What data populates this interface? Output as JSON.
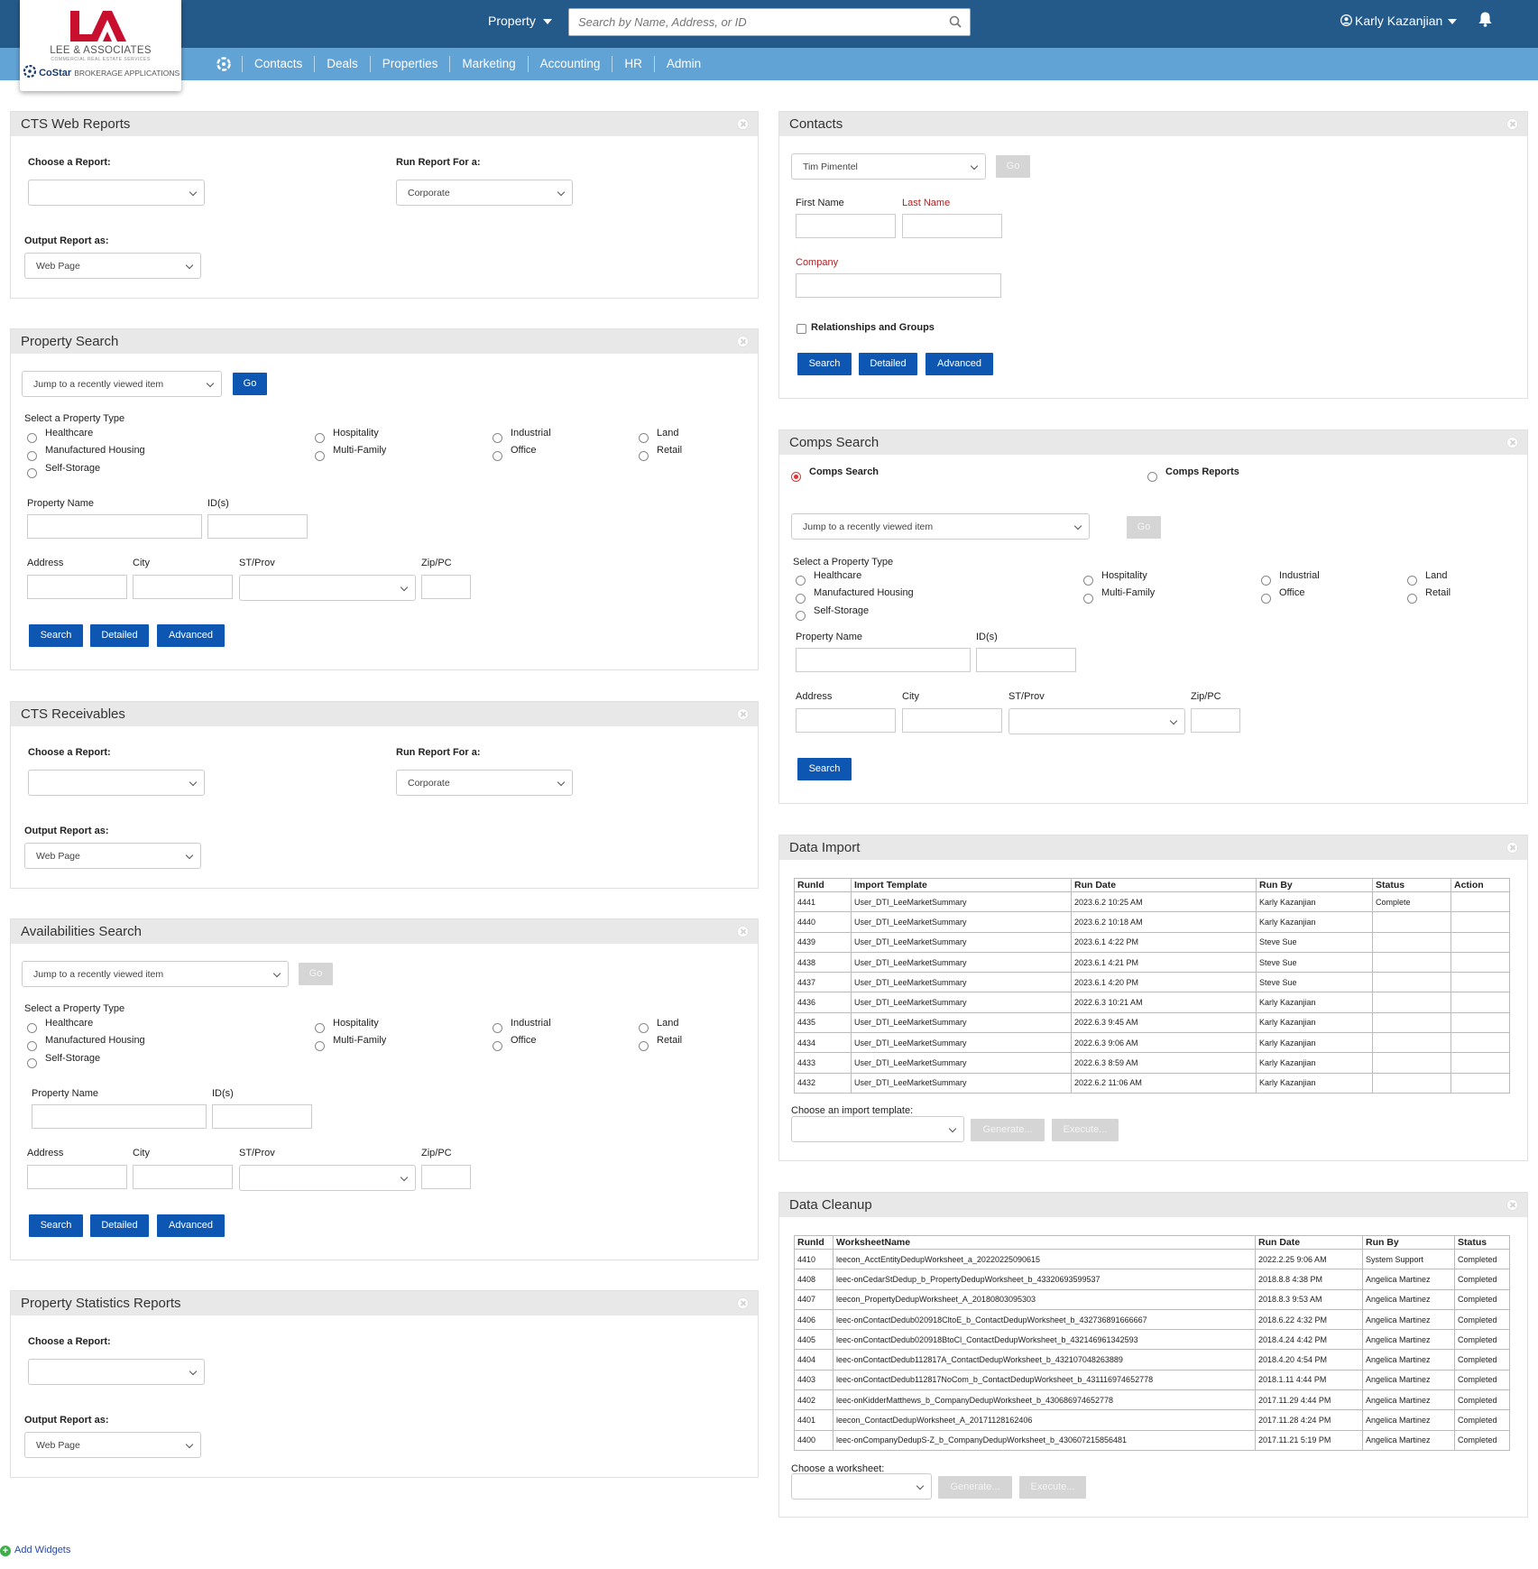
{
  "header": {
    "logo": {
      "name": "LEE & ASSOCIATES",
      "sub": "COMMERCIAL REAL ESTATE SERVICES",
      "costar_brand": "CoStar",
      "costar_sub": "BROKERAGE APPLICATIONS"
    },
    "property_dropdown": "Property",
    "search_placeholder": "Search by Name, Address, or ID",
    "user": "Karly Kazanjian"
  },
  "nav": [
    "Contacts",
    "Deals",
    "Properties",
    "Marketing",
    "Accounting",
    "HR",
    "Admin"
  ],
  "cts_web_reports": {
    "title": "CTS Web Reports",
    "choose_label": "Choose a Report:",
    "choose_value": "",
    "run_for_label": "Run Report For a:",
    "run_for_value": "Corporate",
    "output_label": "Output Report as:",
    "output_value": "Web Page"
  },
  "property_search": {
    "title": "Property Search",
    "jump_value": "Jump to a recently viewed item",
    "go": "Go",
    "type_label": "Select a Property Type",
    "types": [
      "Healthcare",
      "Manufactured Housing",
      "Self-Storage",
      "Hospitality",
      "Multi-Family",
      "Industrial",
      "Office",
      "Land",
      "Retail"
    ],
    "property_name_label": "Property Name",
    "ids_label": "ID(s)",
    "address_label": "Address",
    "city_label": "City",
    "st_label": "ST/Prov",
    "zip_label": "Zip/PC",
    "search": "Search",
    "detailed": "Detailed",
    "advanced": "Advanced"
  },
  "cts_receivables": {
    "title": "CTS Receivables",
    "choose_label": "Choose a Report:",
    "run_for_label": "Run Report For a:",
    "run_for_value": "Corporate",
    "output_label": "Output Report as:",
    "output_value": "Web Page"
  },
  "availabilities_search": {
    "title": "Availabilities Search",
    "jump_value": "Jump to a recently viewed item",
    "go": "Go",
    "type_label": "Select a Property Type",
    "types": [
      "Healthcare",
      "Manufactured Housing",
      "Self-Storage",
      "Hospitality",
      "Multi-Family",
      "Industrial",
      "Office",
      "Land",
      "Retail"
    ],
    "property_name_label": "Property Name",
    "ids_label": "ID(s)",
    "address_label": "Address",
    "city_label": "City",
    "st_label": "ST/Prov",
    "zip_label": "Zip/PC",
    "search": "Search",
    "detailed": "Detailed",
    "advanced": "Advanced"
  },
  "property_statistics": {
    "title": "Property Statistics Reports",
    "choose_label": "Choose a Report:",
    "output_label": "Output Report as:",
    "output_value": "Web Page"
  },
  "contacts": {
    "title": "Contacts",
    "select_value": "Tim Pimentel",
    "go": "Go",
    "first_name_label": "First Name",
    "last_name_label": "Last Name",
    "company_label": "Company",
    "relationships_label": "Relationships and Groups",
    "search": "Search",
    "detailed": "Detailed",
    "advanced": "Advanced"
  },
  "comps_search": {
    "title": "Comps Search",
    "option_search": "Comps Search",
    "option_reports": "Comps Reports",
    "jump_value": "Jump to a recently viewed item",
    "go": "Go",
    "type_label": "Select a Property Type",
    "types": [
      "Healthcare",
      "Manufactured Housing",
      "Self-Storage",
      "Hospitality",
      "Multi-Family",
      "Industrial",
      "Office",
      "Land",
      "Retail"
    ],
    "property_name_label": "Property Name",
    "ids_label": "ID(s)",
    "address_label": "Address",
    "city_label": "City",
    "st_label": "ST/Prov",
    "zip_label": "Zip/PC",
    "search": "Search"
  },
  "data_import": {
    "title": "Data Import",
    "columns": [
      "RunId",
      "Import Template",
      "Run Date",
      "Run By",
      "Status",
      "Action"
    ],
    "rows": [
      [
        "4441",
        "User_DTI_LeeMarketSummary",
        "2023.6.2 10:25 AM",
        "Karly Kazanjian",
        "Complete",
        ""
      ],
      [
        "4440",
        "User_DTI_LeeMarketSummary",
        "2023.6.2 10:18 AM",
        "Karly Kazanjian",
        "",
        ""
      ],
      [
        "4439",
        "User_DTI_LeeMarketSummary",
        "2023.6.1 4:22 PM",
        "Steve Sue",
        "",
        ""
      ],
      [
        "4438",
        "User_DTI_LeeMarketSummary",
        "2023.6.1 4:21 PM",
        "Steve Sue",
        "",
        ""
      ],
      [
        "4437",
        "User_DTI_LeeMarketSummary",
        "2023.6.1 4:20 PM",
        "Steve Sue",
        "",
        ""
      ],
      [
        "4436",
        "User_DTI_LeeMarketSummary",
        "2022.6.3 10:21 AM",
        "Karly Kazanjian",
        "",
        ""
      ],
      [
        "4435",
        "User_DTI_LeeMarketSummary",
        "2022.6.3 9:45 AM",
        "Karly Kazanjian",
        "",
        ""
      ],
      [
        "4434",
        "User_DTI_LeeMarketSummary",
        "2022.6.3 9:06 AM",
        "Karly Kazanjian",
        "",
        ""
      ],
      [
        "4433",
        "User_DTI_LeeMarketSummary",
        "2022.6.3 8:59 AM",
        "Karly Kazanjian",
        "",
        ""
      ],
      [
        "4432",
        "User_DTI_LeeMarketSummary",
        "2022.6.2 11:06 AM",
        "Karly Kazanjian",
        "",
        ""
      ]
    ],
    "choose_label": "Choose an import template:",
    "generate": "Generate...",
    "execute": "Execute..."
  },
  "data_cleanup": {
    "title": "Data Cleanup",
    "columns": [
      "RunId",
      "WorksheetName",
      "Run Date",
      "Run By",
      "Status"
    ],
    "rows": [
      [
        "4410",
        "leecon_AcctEntityDedupWorksheet_a_20220225090615",
        "2022.2.25 9:06 AM",
        "System Support",
        "Completed"
      ],
      [
        "4408",
        "leec-onCedarStDedup_b_PropertyDedupWorksheet_b_43320693599537",
        "2018.8.8 4:38 PM",
        "Angelica Martinez",
        "Completed"
      ],
      [
        "4407",
        "leecon_PropertyDedupWorksheet_A_20180803095303",
        "2018.8.3 9:53 AM",
        "Angelica Martinez",
        "Completed"
      ],
      [
        "4406",
        "leec-onContactDedub020918CltoE_b_ContactDedupWorksheet_b_432736891666667",
        "2018.6.22 4:32 PM",
        "Angelica Martinez",
        "Completed"
      ],
      [
        "4405",
        "leec-onContactDedub020918BtoCl_ContactDedupWorksheet_b_432146961342593",
        "2018.4.24 4:42 PM",
        "Angelica Martinez",
        "Completed"
      ],
      [
        "4404",
        "leec-onContactDedub112817A_ContactDedupWorksheet_b_432107048263889",
        "2018.4.20 4:54 PM",
        "Angelica Martinez",
        "Completed"
      ],
      [
        "4403",
        "leec-onContactDedub112817NoCom_b_ContactDedupWorksheet_b_431116974652778",
        "2018.1.11 4:44 PM",
        "Angelica Martinez",
        "Completed"
      ],
      [
        "4402",
        "leec-onKidderMatthews_b_CompanyDedupWorksheet_b_430686974652778",
        "2017.11.29 4:44 PM",
        "Angelica Martinez",
        "Completed"
      ],
      [
        "4401",
        "leecon_ContactDedupWorksheet_A_20171128162406",
        "2017.11.28 4:24 PM",
        "Angelica Martinez",
        "Completed"
      ],
      [
        "4400",
        "leec-onCompanyDedupS-Z_b_CompanyDedupWorksheet_b_430607215856481",
        "2017.11.21 5:19 PM",
        "Angelica Martinez",
        "Completed"
      ]
    ],
    "choose_label": "Choose a worksheet:",
    "generate": "Generate...",
    "execute": "Execute..."
  },
  "add_widgets": "Add Widgets"
}
